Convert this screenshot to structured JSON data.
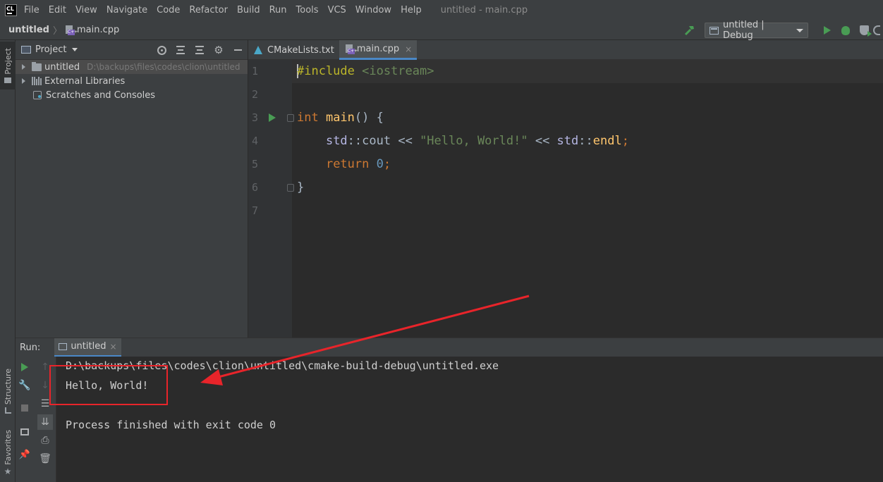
{
  "menubar": {
    "logo_text": "CL",
    "items": [
      "File",
      "Edit",
      "View",
      "Navigate",
      "Code",
      "Refactor",
      "Build",
      "Run",
      "Tools",
      "VCS",
      "Window",
      "Help"
    ],
    "window_title": "untitled - main.cpp"
  },
  "navbar": {
    "project": "untitled",
    "file": "main.cpp",
    "run_config": "untitled | Debug"
  },
  "left_stripe": {
    "project": "Project",
    "structure": "Structure",
    "favorites": "Favorites"
  },
  "project_panel": {
    "title": "Project",
    "tree": [
      {
        "label": "untitled",
        "path": "D:\\backups\\files\\codes\\clion\\untitled"
      },
      {
        "label": "External Libraries"
      },
      {
        "label": "Scratches and Consoles"
      }
    ]
  },
  "editor": {
    "tabs": [
      {
        "label": "CMakeLists.txt",
        "close": "×"
      },
      {
        "label": "main.cpp",
        "close": "×"
      }
    ],
    "line_numbers": [
      "1",
      "2",
      "3",
      "4",
      "5",
      "6",
      "7"
    ],
    "code": {
      "l1_pre": "#include",
      "l1_rest": " <iostream>",
      "l3_kw": "int",
      "l3_fn": " main",
      "l3_rest": "() {",
      "l4_indent": "    ",
      "l4_ns1": "std",
      "l4_op1": "::",
      "l4_cout": "cout",
      "l4_op2": " << ",
      "l4_str": "\"Hello, World!\"",
      "l4_op3": " << ",
      "l4_ns2": "std",
      "l4_op4": "::",
      "l4_endl": "endl",
      "l4_semi": ";",
      "l5_indent": "    ",
      "l5_kw": "return",
      "l5_sp": " ",
      "l5_num": "0",
      "l5_semi": ";",
      "l6": "}"
    }
  },
  "run_panel": {
    "title": "Run:",
    "tab": "untitled",
    "tab_close": "×",
    "console": [
      "D:\\backups\\files\\codes\\clion\\untitled\\cmake-build-debug\\untitled.exe",
      "Hello, World!",
      "",
      "Process finished with exit code 0"
    ]
  },
  "annotation_color": "#e8242a"
}
